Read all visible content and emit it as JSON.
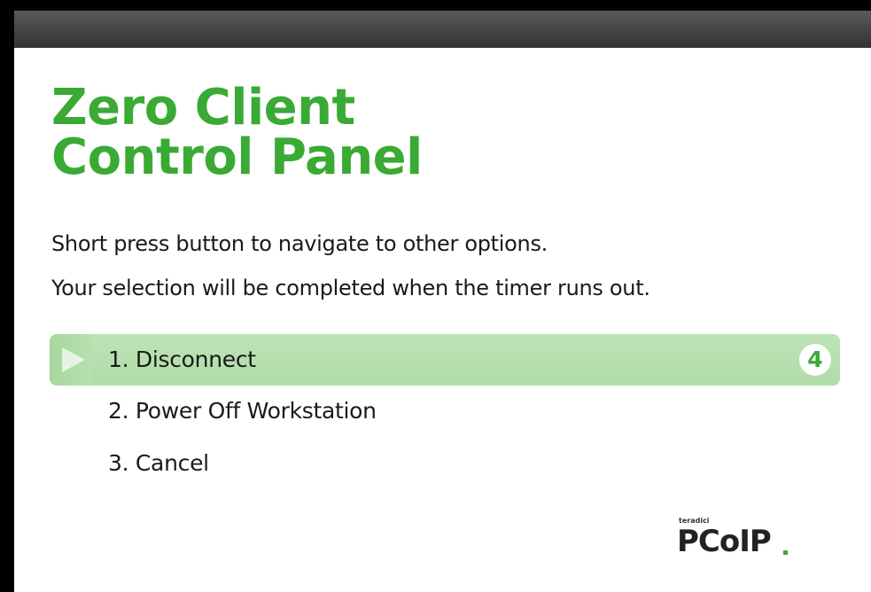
{
  "colors": {
    "title_green": "#3aaa35",
    "selection_green": "#b5deae",
    "titlebar_gray": "#4a4a4a",
    "panel_background": "#ffffff"
  },
  "heading": {
    "line1": "Zero Client",
    "line2": "Control Panel"
  },
  "instructions": {
    "line1": "Short press button to navigate to other options.",
    "line2": "Your selection will be completed when the timer runs out."
  },
  "menu": {
    "items": [
      {
        "label": "1. Disconnect",
        "selected": true
      },
      {
        "label": "2. Power Off Workstation",
        "selected": false
      },
      {
        "label": "3. Cancel",
        "selected": false
      }
    ],
    "timer": "4",
    "selection_icon": "play-arrow-icon",
    "timer_icon": "countdown-circle-icon"
  },
  "brand": {
    "company": "teradici",
    "product": "PCoIP"
  }
}
